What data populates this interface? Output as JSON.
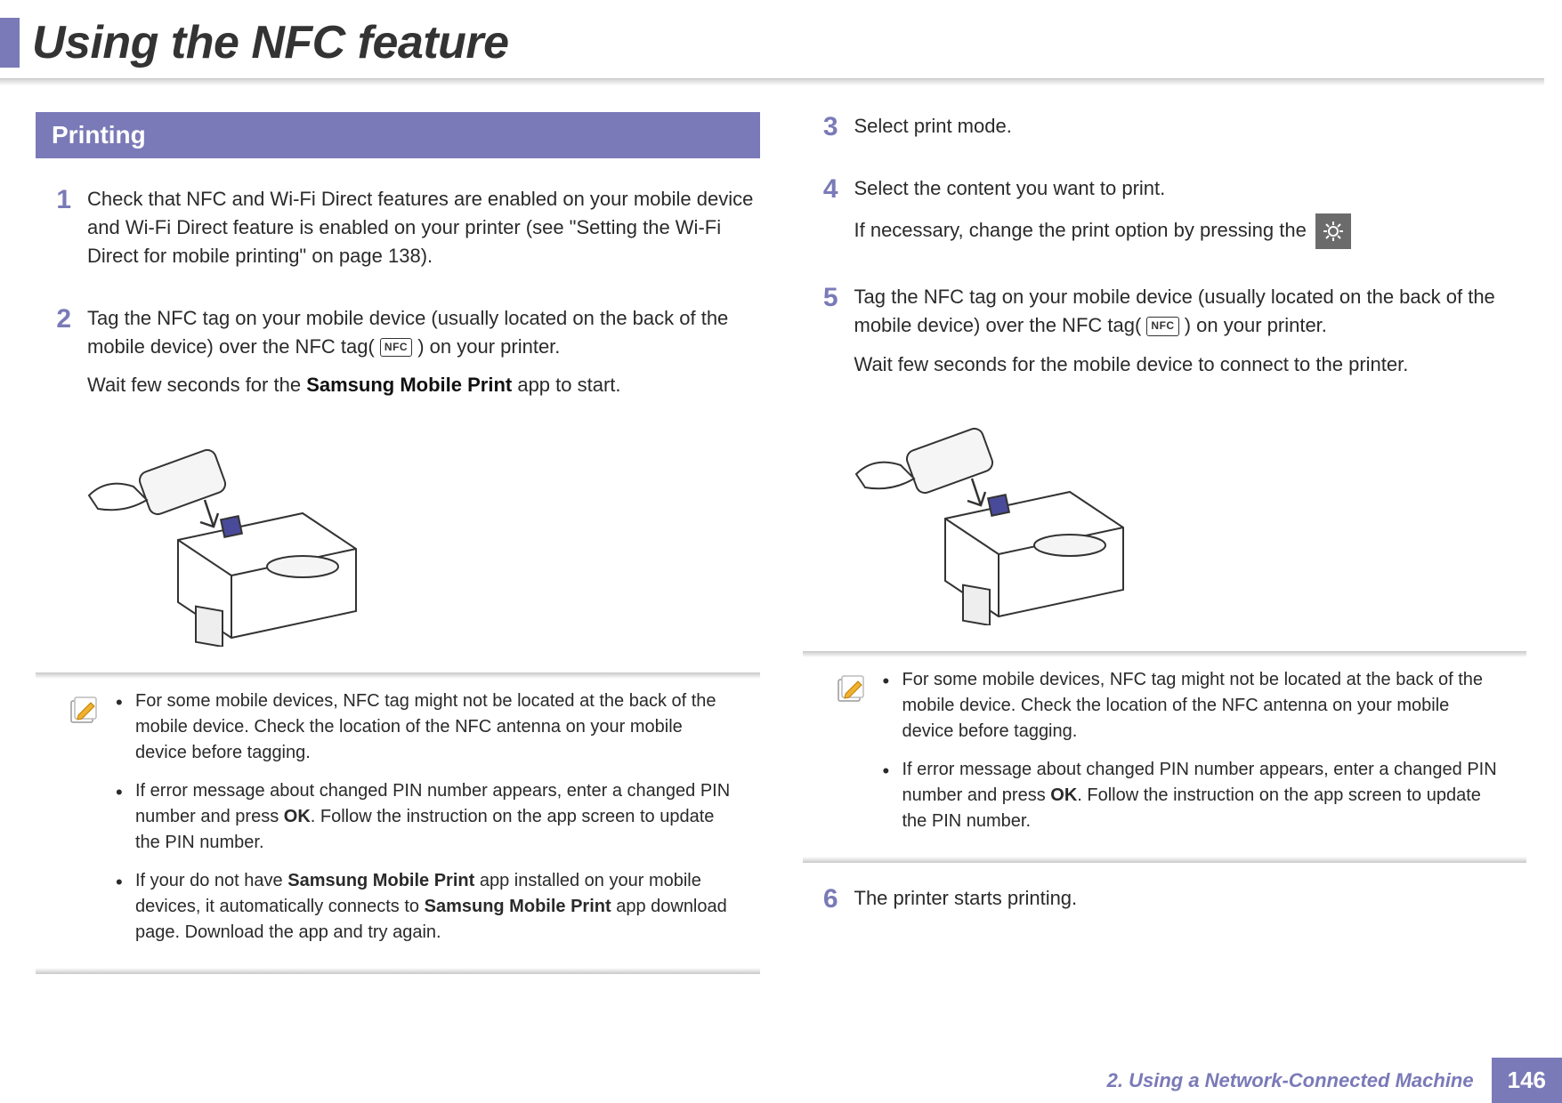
{
  "header": {
    "title": "Using the NFC feature"
  },
  "section": {
    "heading": "Printing"
  },
  "left": {
    "step1": {
      "num": "1",
      "text": "Check that NFC and Wi-Fi Direct features are enabled on your mobile device and Wi-Fi Direct feature is enabled on your printer (see \"Setting the Wi-Fi Direct for mobile printing\" on page 138)."
    },
    "step2": {
      "num": "2",
      "line1a": "Tag the NFC tag on your mobile device (usually located on the back of the mobile device) over the NFC tag(",
      "nfc_label": "NFC",
      "line1b": ") on your printer.",
      "line2a": "Wait few seconds for the ",
      "line2bold": "Samsung Mobile Print",
      "line2b": " app to start."
    },
    "note": {
      "b1": "For some mobile devices, NFC tag might not be located at the back of the mobile device. Check the location of the NFC antenna on your mobile device before tagging.",
      "b2a": "If error message about changed PIN number appears, enter a changed PIN number and press ",
      "b2bold": "OK",
      "b2b": ". Follow the instruction on the app screen to update the PIN number.",
      "b3a": "If your do not have ",
      "b3bold1": "Samsung Mobile Print",
      "b3b": " app installed on your mobile devices, it automatically connects to ",
      "b3bold2": "Samsung Mobile Print",
      "b3c": " app download page. Download the app and try again."
    }
  },
  "right": {
    "step3": {
      "num": "3",
      "text": "Select print mode."
    },
    "step4": {
      "num": "4",
      "line1": "Select the content you want to print.",
      "line2": "If necessary, change the print option by pressing the"
    },
    "step5": {
      "num": "5",
      "line1a": "Tag the NFC tag on your mobile device (usually located on the back of the mobile device) over the NFC tag(",
      "nfc_label": "NFC",
      "line1b": ") on your printer.",
      "line2": "Wait few seconds for the mobile device to connect to the printer."
    },
    "note": {
      "b1": "For some mobile devices, NFC tag might not be located at the back of the mobile device. Check the location of the NFC antenna on your mobile device before tagging.",
      "b2a": "If error message about changed PIN number appears, enter a changed PIN number and press ",
      "b2bold": "OK",
      "b2b": ". Follow the instruction on the app screen to update the PIN number."
    },
    "step6": {
      "num": "6",
      "text": "The printer starts printing."
    }
  },
  "footer": {
    "chapter": "2.  Using a Network-Connected Machine",
    "page": "146"
  }
}
